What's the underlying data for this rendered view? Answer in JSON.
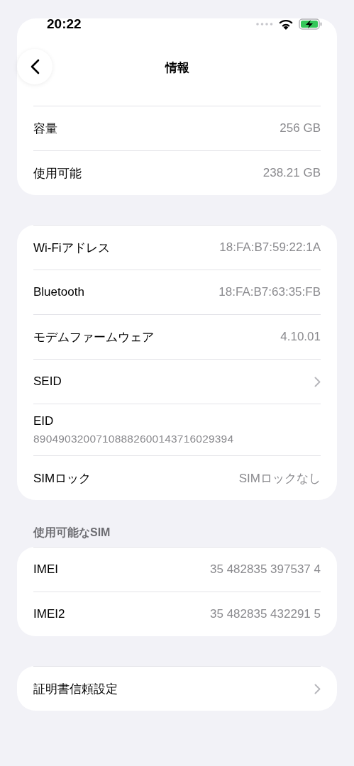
{
  "status_bar": {
    "time": "20:22"
  },
  "nav": {
    "title": "情報"
  },
  "sections": [
    {
      "rows": [
        {
          "kind": "value",
          "label": "容量",
          "value": "256 GB",
          "faded": false
        },
        {
          "kind": "value",
          "label": "使用可能",
          "value": "238.21 GB",
          "faded": false
        }
      ]
    },
    {
      "rows": [
        {
          "kind": "value",
          "label": "Wi-Fiアドレス",
          "value": "18:FA:B7:59:22:1A",
          "faded": false
        },
        {
          "kind": "value",
          "label": "Bluetooth",
          "value": "18:FA:B7:63:35:FB",
          "faded": false
        },
        {
          "kind": "value",
          "label": "モデムファームウェア",
          "value": "4.10.01",
          "faded": false
        },
        {
          "kind": "chevron",
          "label": "SEID",
          "faded": false
        },
        {
          "kind": "stacked",
          "label": "EID",
          "value": "89049032007108882600143716029394",
          "faded": false
        },
        {
          "kind": "value",
          "label": "SIMロック",
          "value": "SIMロックなし",
          "faded": false
        }
      ]
    },
    {
      "header": "使用可能なSIM",
      "rows": [
        {
          "kind": "value",
          "label": "IMEI",
          "value": "35 482835 397537 4",
          "faded": false
        },
        {
          "kind": "value",
          "label": "IMEI2",
          "value": "35 482835 432291 5",
          "faded": false
        }
      ]
    },
    {
      "rows": [
        {
          "kind": "chevron",
          "label": "証明書信頼設定",
          "faded": false
        }
      ]
    }
  ]
}
